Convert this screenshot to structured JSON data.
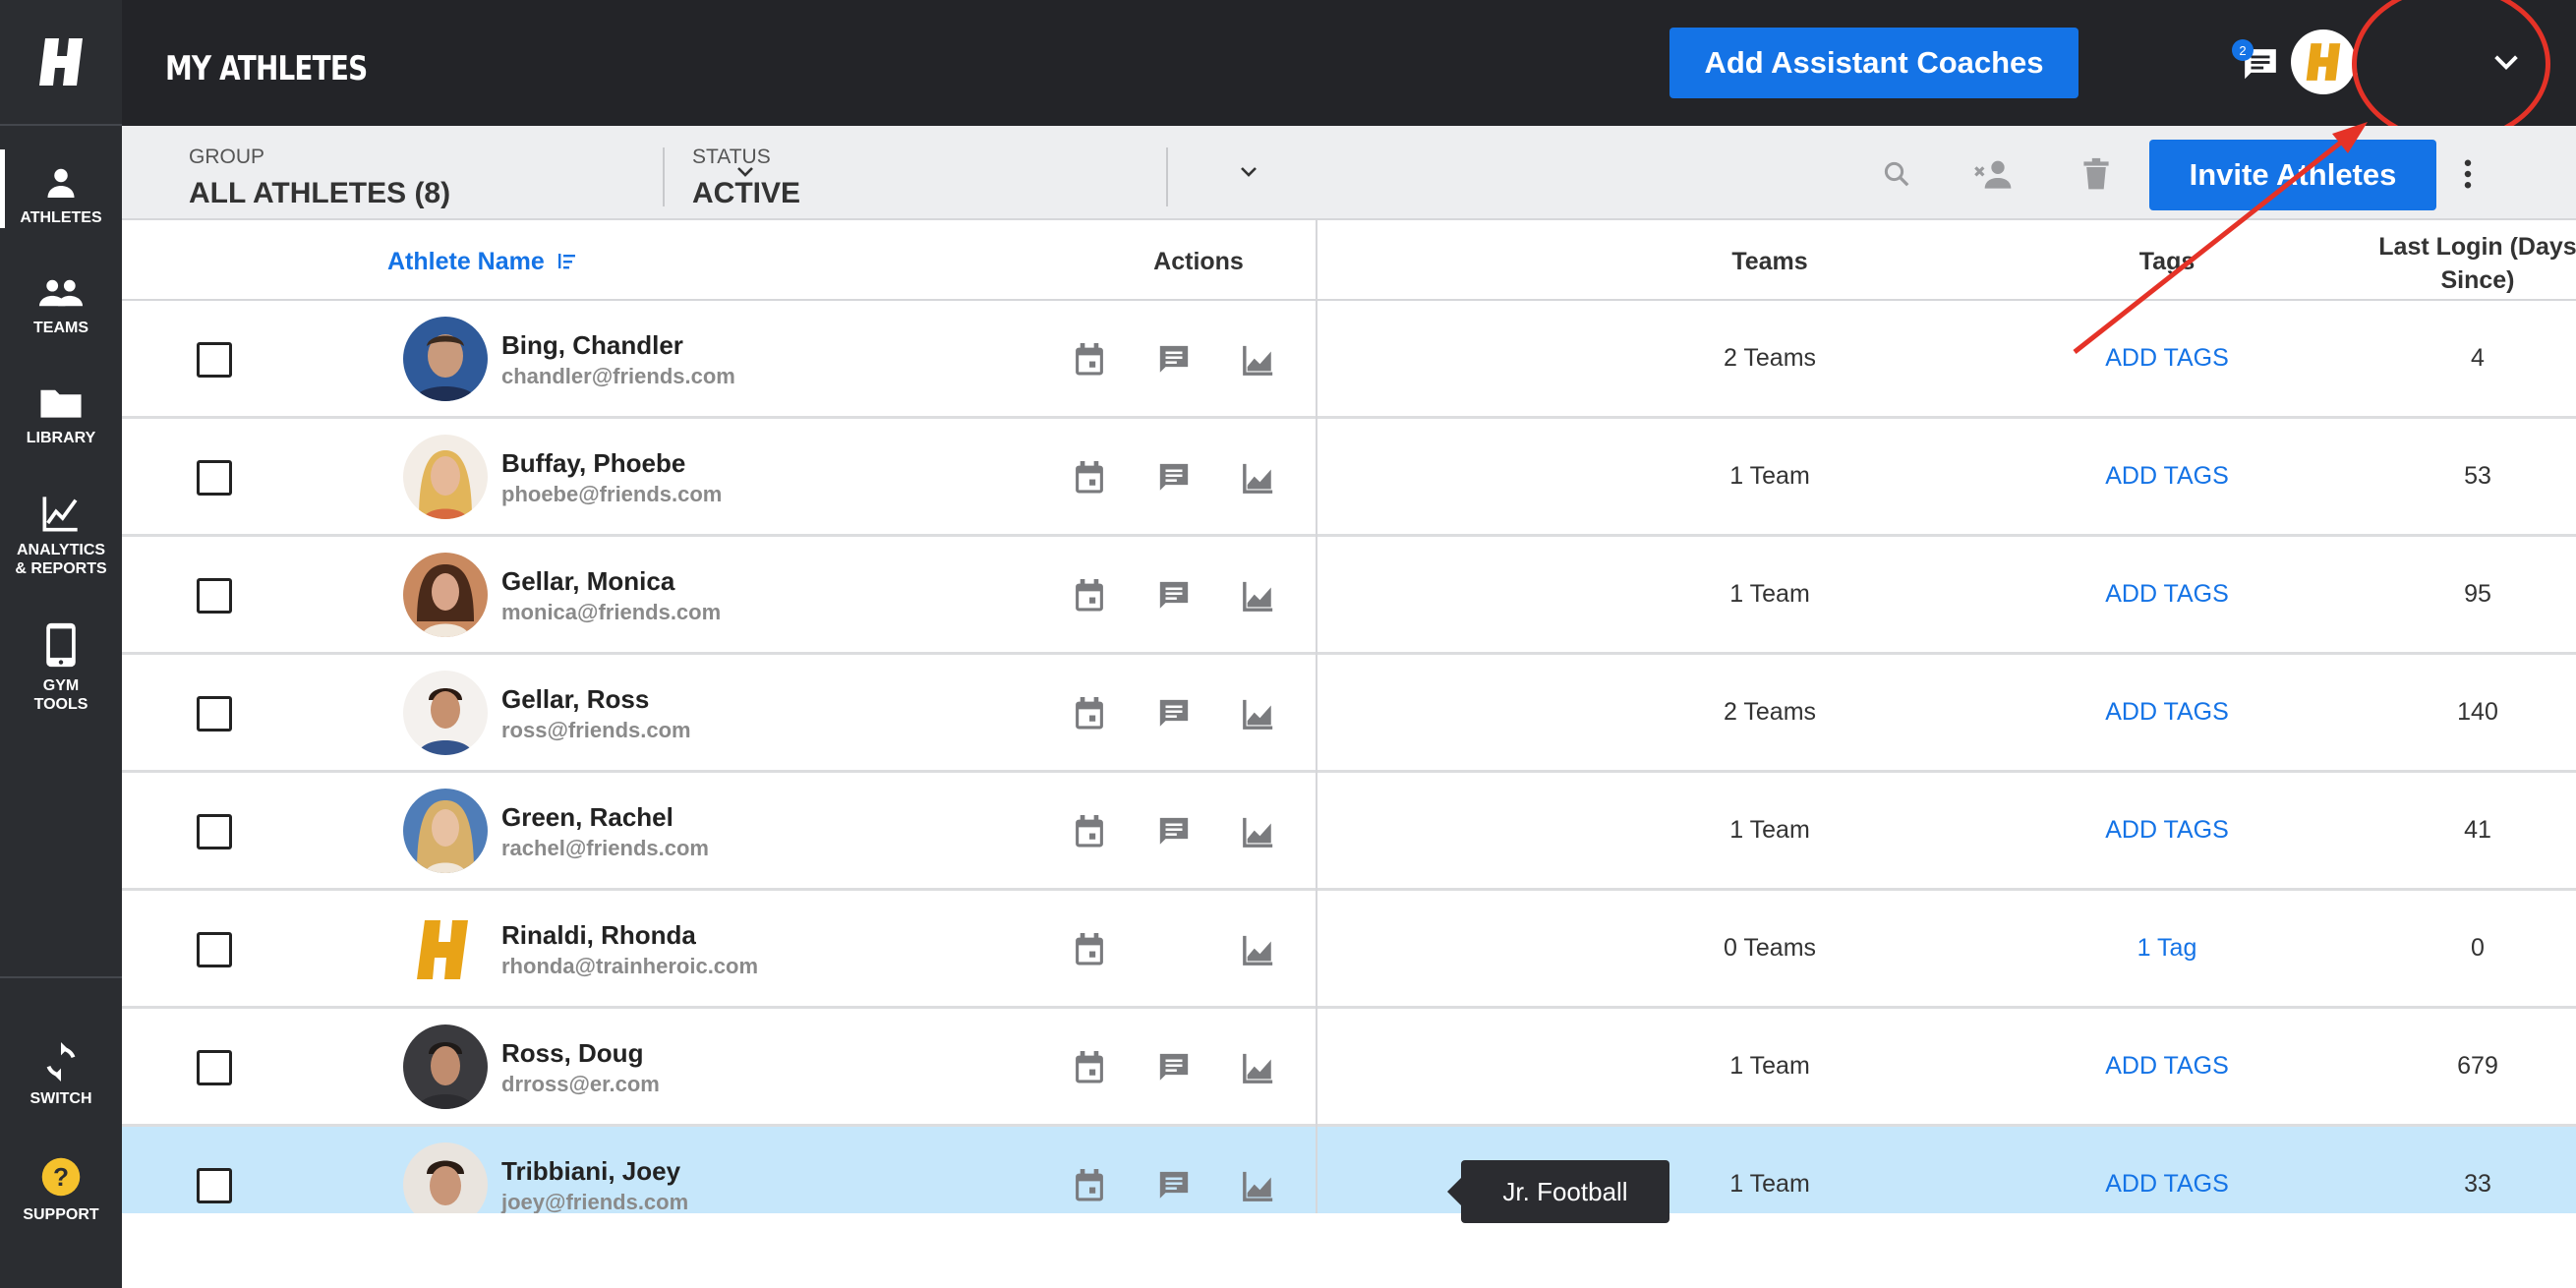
{
  "sidebar": {
    "logo_letter": "H",
    "items": [
      {
        "label": "ATHLETES",
        "icon": "person-icon"
      },
      {
        "label": "TEAMS",
        "icon": "group-icon"
      },
      {
        "label": "LIBRARY",
        "icon": "folder-icon"
      },
      {
        "label_line1": "ANALYTICS",
        "label_line2": "& REPORTS",
        "icon": "chart-line-icon"
      },
      {
        "label_line1": "GYM",
        "label_line2": "TOOLS",
        "icon": "tablet-icon"
      },
      {
        "label": "SWITCH",
        "icon": "switch-icon"
      },
      {
        "label": "SUPPORT",
        "icon": "help-icon"
      }
    ]
  },
  "header": {
    "title": "MY ATHLETES",
    "add_coaches_label": "Add Assistant Coaches",
    "notification_count": "2",
    "brand_color": "#e8a317",
    "accent_color": "#1473e6"
  },
  "filters": {
    "group_label": "GROUP",
    "group_value": "ALL ATHLETES (8)",
    "status_label": "STATUS",
    "status_value": "ACTIVE",
    "invite_label": "Invite Athletes"
  },
  "table": {
    "headers": {
      "name": "Athlete Name",
      "actions": "Actions",
      "teams": "Teams",
      "tags": "Tags",
      "login_line1": "Last Login (Days",
      "login_line2": "Since)"
    },
    "rows": [
      {
        "name": "Bing, Chandler",
        "email": "chandler@friends.com",
        "teams": "2 Teams",
        "tags": "ADD TAGS",
        "login": "4"
      },
      {
        "name": "Buffay, Phoebe",
        "email": "phoebe@friends.com",
        "teams": "1 Team",
        "tags": "ADD TAGS",
        "login": "53"
      },
      {
        "name": "Gellar, Monica",
        "email": "monica@friends.com",
        "teams": "1 Team",
        "tags": "ADD TAGS",
        "login": "95"
      },
      {
        "name": "Gellar, Ross",
        "email": "ross@friends.com",
        "teams": "2 Teams",
        "tags": "ADD TAGS",
        "login": "140"
      },
      {
        "name": "Green, Rachel",
        "email": "rachel@friends.com",
        "teams": "1 Team",
        "tags": "ADD TAGS",
        "login": "41"
      },
      {
        "name": "Rinaldi, Rhonda",
        "email": "rhonda@trainheroic.com",
        "teams": "0 Teams",
        "tags": "1 Tag",
        "login": "0"
      },
      {
        "name": "Ross, Doug",
        "email": "drross@er.com",
        "teams": "1 Team",
        "tags": "ADD TAGS",
        "login": "679"
      },
      {
        "name": "Tribbiani, Joey",
        "email": "joey@friends.com",
        "teams": "1 Team",
        "tags": "ADD TAGS",
        "login": "33"
      }
    ],
    "tooltip": "Jr. Football"
  }
}
